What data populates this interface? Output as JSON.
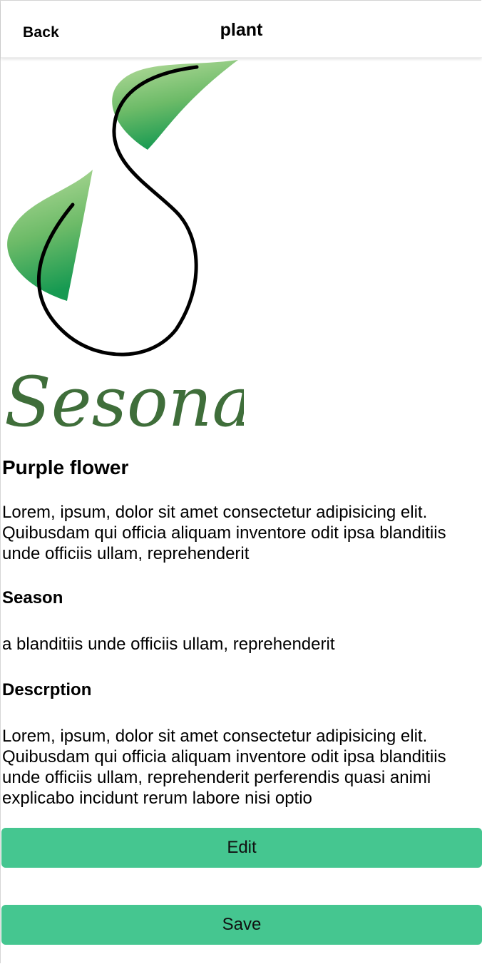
{
  "header": {
    "back_label": "Back",
    "title": "plant"
  },
  "logo": {
    "wordmark": "Sesonal",
    "leaf_color_light": "#a8d58e",
    "leaf_color_dark": "#179a52",
    "wordmark_color": "#3f6e3a"
  },
  "plant": {
    "name": "Purple flower",
    "summary": "Lorem, ipsum, dolor sit amet consectetur adipisicing elit. Quibusdam qui officia aliquam inventore odit ipsa blanditiis unde officiis ullam, reprehenderit",
    "season_label": "Season",
    "season_value": "a blanditiis unde officiis ullam, reprehenderit",
    "description_label": "Descrption",
    "description_value": "Lorem, ipsum, dolor sit amet consectetur adipisicing elit. Quibusdam qui officia aliquam inventore odit ipsa blanditiis unde officiis ullam, reprehenderit perferendis quasi animi explicabo incidunt rerum labore nisi optio"
  },
  "actions": {
    "edit_label": "Edit",
    "save_label": "Save",
    "button_color": "#45c690"
  }
}
